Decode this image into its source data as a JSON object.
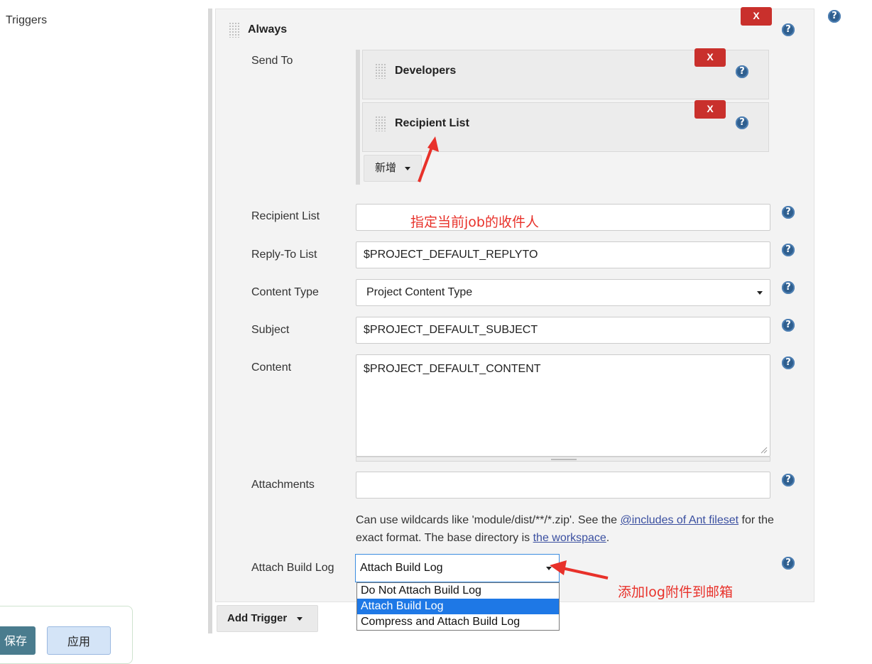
{
  "section": {
    "label": "Triggers"
  },
  "trigger": {
    "title": "Always",
    "remove_label": "X"
  },
  "send_to": {
    "label": "Send To",
    "items": [
      {
        "title": "Developers",
        "remove_label": "X"
      },
      {
        "title": "Recipient List",
        "remove_label": "X"
      }
    ],
    "add_button": "新增"
  },
  "fields": {
    "recipient_list": {
      "label": "Recipient List",
      "value": ""
    },
    "reply_to": {
      "label": "Reply-To List",
      "value": "$PROJECT_DEFAULT_REPLYTO"
    },
    "content_type": {
      "label": "Content Type",
      "value": "Project Content Type"
    },
    "subject": {
      "label": "Subject",
      "value": "$PROJECT_DEFAULT_SUBJECT"
    },
    "content": {
      "label": "Content",
      "value": "$PROJECT_DEFAULT_CONTENT"
    },
    "attachments": {
      "label": "Attachments",
      "value": "",
      "help_text_1": "Can use wildcards like 'module/dist/**/*.zip'. See the ",
      "help_link_1": "@includes of Ant fileset",
      "help_text_2": " for the exact format. The base directory is ",
      "help_link_2": "the workspace",
      "help_text_3": "."
    },
    "attach_build_log": {
      "label": "Attach Build Log",
      "value": "Attach Build Log",
      "options": [
        "Do Not Attach Build Log",
        "Attach Build Log",
        "Compress and Attach Build Log"
      ],
      "selected_index": 1
    }
  },
  "add_trigger": "Add Trigger",
  "footer_buttons": {
    "save": "保存",
    "apply": "应用"
  },
  "annotations": {
    "recipient_note": "指定当前job的收件人",
    "log_note": "添加log附件到邮箱"
  },
  "help_icon": "?",
  "colors": {
    "accent_red": "#e8312a",
    "remove_red": "#c9302c",
    "select_blue": "#1e78e6"
  }
}
